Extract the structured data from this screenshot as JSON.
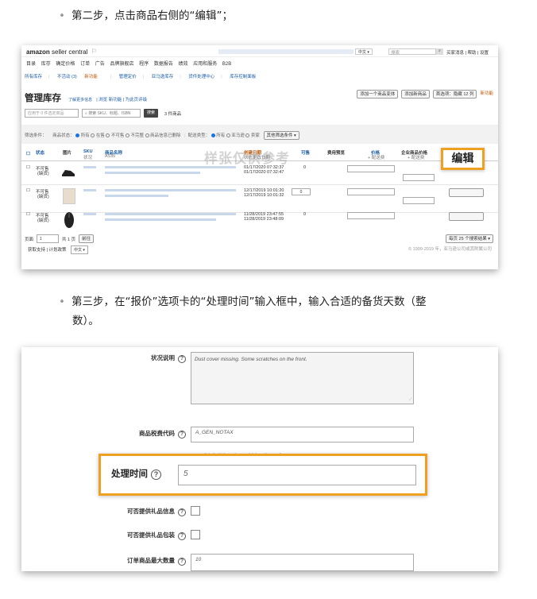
{
  "step2": {
    "bullet": "•",
    "text": "第二步，点击商品右侧的“编辑”；"
  },
  "step3": {
    "bullet": "•",
    "line1": "第三步，在“报价”选项卡的“处理时间”输入框中，输入合适的备货天数（整",
    "line2": "数）。"
  },
  "seller_central": {
    "logo_brand": "amazon",
    "logo_suffix": "seller central",
    "language": "中文",
    "search_placeholder": "搜索",
    "search_icon": "magnifier-icon",
    "top_links": "买家消息 | 帮助 | 设置",
    "nav_items": [
      "目录",
      "库存",
      "确定价格",
      "订单",
      "广告",
      "品牌旗舰店",
      "程序",
      "数据报告",
      "绩效",
      "应用和服务",
      "B2B"
    ],
    "sub_nav": [
      {
        "label": "所有库存"
      },
      {
        "label": "不活动 (3)",
        "badge": "新功能"
      },
      {
        "label": "管理定价"
      },
      {
        "label": "亚马逊库存"
      },
      {
        "label": "货件处理中心"
      },
      {
        "label": "库存控制面板"
      }
    ],
    "page_title": "管理库存",
    "learn_more": "了解更多信息",
    "learn_links": "| 浏览 新功能 | 为此页评级",
    "right_buttons": [
      "添加一个商品变体",
      "添加新商品",
      "首选项：隐藏 12 列"
    ],
    "right_badge": "新功能",
    "search_input_placeholder": "应用于 0 件选定商品",
    "search_sku_placeholder": "搜索 SKU、标题、ISBN",
    "search_button": "搜索",
    "count_label": "3 件商品",
    "filter_label": "筛选条件：",
    "filter_status_label": "商品状态：",
    "filter_status_options": [
      "所有",
      "在售",
      "不可售",
      "不完整",
      "商品信息已删除"
    ],
    "fulfillment_label": "配送类型：",
    "fulfillment_options": [
      "所有",
      "亚马逊",
      "卖家"
    ],
    "more_filters": "其他筛选条件",
    "columns": [
      "状态",
      "图片",
      "SKU",
      "商品名称",
      "创建日期",
      "可售",
      "费用预览",
      "价格",
      "企业商品价格"
    ],
    "column_subs": [
      "",
      "",
      "状况",
      "ASIN",
      "状态更改日期",
      "",
      "",
      "+ 配送费",
      "+ 配送费"
    ],
    "rows": [
      {
        "status": "不可售",
        "status_sub": "(缺货)",
        "created": "01/17/2020 07:32:37",
        "updated": "01/17/2020 07:32:47",
        "qty": "0"
      },
      {
        "status": "不可售",
        "status_sub": "(缺货)",
        "created": "12/17/2019 10:01:20",
        "updated": "12/17/2019 10:01:32",
        "qty": "0"
      },
      {
        "status": "不可售",
        "status_sub": "(缺货)",
        "created": "11/28/2019 23:47:55",
        "updated": "11/28/2019 23:48:09",
        "qty": "0"
      }
    ],
    "edit_callout": "编辑",
    "pager_prefix": "页面",
    "pager_page": "1",
    "pager_suffix": "共 1 页",
    "pager_go": "前往",
    "per_page": "每页 25 个搜索结果",
    "footer_links": "获取支持  |  计划政策",
    "footer_lang": "中文",
    "copyright": "© 1999-2019 年，亚马逊公司或其附属公司"
  },
  "watermark": "样张仅供参考",
  "offer_form": {
    "condition_label": "状况说明",
    "condition_value": "Dust cover missing. Some scratches on the front.",
    "tax_label": "商品税费代码",
    "tax_value": "A_GEN_NOTAX",
    "handling_label": "处理时间",
    "handling_value": "5",
    "gift_message_label": "可否提供礼品信息",
    "gift_wrap_label": "可否提供礼品包装",
    "max_qty_label": "订单商品最大数量",
    "max_qty_value": "10"
  }
}
